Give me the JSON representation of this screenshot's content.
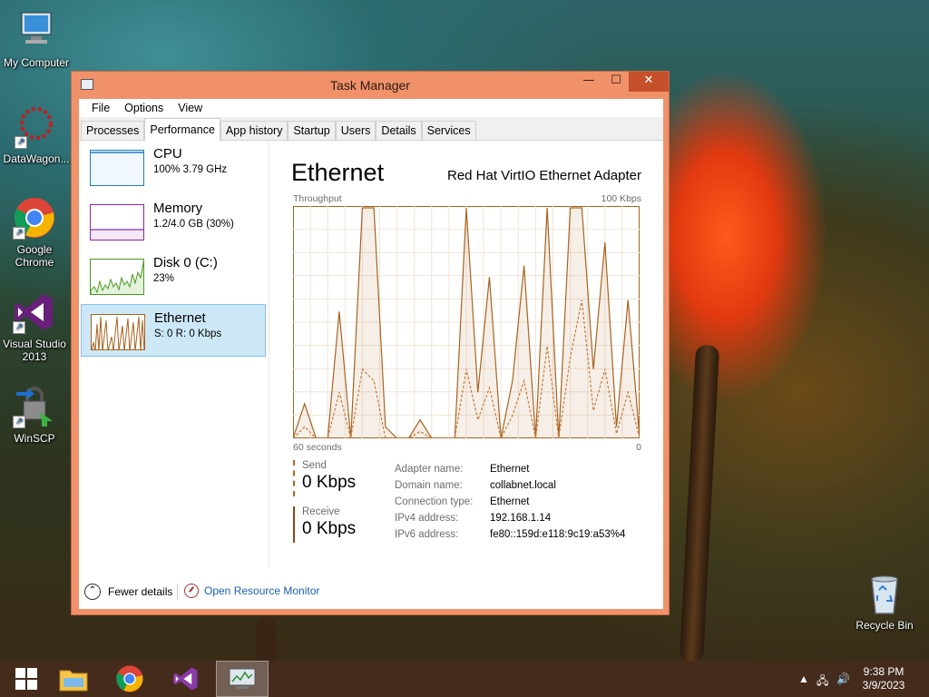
{
  "desktop": {
    "icons": [
      {
        "label": "My Computer",
        "icon": "computer-icon"
      },
      {
        "label": "DataWagon...",
        "icon": "datawagon-icon"
      },
      {
        "label": "Google\nChrome",
        "icon": "chrome-icon"
      },
      {
        "label": "Visual Studio\n2013",
        "icon": "visual-studio-icon"
      },
      {
        "label": "WinSCP",
        "icon": "winscp-icon"
      },
      {
        "label": "Recycle Bin",
        "icon": "recycle-bin-icon"
      }
    ]
  },
  "window": {
    "title": "Task Manager",
    "controls": {
      "minimize": "—",
      "maximize": "☐",
      "close": "✕"
    },
    "menu": [
      "File",
      "Options",
      "View"
    ],
    "tabs": [
      "Processes",
      "Performance",
      "App history",
      "Startup",
      "Users",
      "Details",
      "Services"
    ],
    "active_tab": "Performance"
  },
  "perf_list": [
    {
      "name": "CPU",
      "sub": "100%  3.79 GHz",
      "color": "#1b7fbf"
    },
    {
      "name": "Memory",
      "sub": "1.2/4.0 GB (30%)",
      "color": "#8b28a8"
    },
    {
      "name": "Disk 0 (C:)",
      "sub": "23%",
      "color": "#4a9a1f"
    },
    {
      "name": "Ethernet",
      "sub": "S: 0  R: 0 Kbps",
      "color": "#a8631e"
    }
  ],
  "detail": {
    "heading": "Ethernet",
    "adapter": "Red Hat VirtIO Ethernet Adapter",
    "throughput_label": "Throughput",
    "throughput_max": "100 Kbps",
    "axis_left": "60 seconds",
    "axis_right": "0",
    "send_label": "Send",
    "send_value": "0 Kbps",
    "receive_label": "Receive",
    "receive_value": "0 Kbps",
    "properties": [
      {
        "key": "Adapter name:",
        "value": "Ethernet"
      },
      {
        "key": "Domain name:",
        "value": "collabnet.local"
      },
      {
        "key": "Connection type:",
        "value": "Ethernet"
      },
      {
        "key": "IPv4 address:",
        "value": "192.168.1.14"
      },
      {
        "key": "IPv6 address:",
        "value": "fe80::159d:e118:9c19:a53%4"
      }
    ]
  },
  "footer": {
    "fewer_details": "Fewer details",
    "open_resource_monitor": "Open Resource Monitor"
  },
  "chart_data": {
    "type": "line",
    "title": "Throughput",
    "ylim": [
      0,
      100
    ],
    "ylabel": "Kbps",
    "x": [
      60,
      58,
      56,
      54,
      52,
      50,
      48,
      46,
      44,
      42,
      40,
      38,
      36,
      34,
      32,
      30,
      28,
      26,
      24,
      22,
      20,
      18,
      16,
      14,
      12,
      10,
      8,
      6,
      4,
      2,
      0
    ],
    "series": [
      {
        "name": "Send",
        "values": [
          0,
          15,
          0,
          0,
          55,
          0,
          100,
          100,
          5,
          0,
          0,
          8,
          0,
          0,
          0,
          100,
          20,
          70,
          0,
          25,
          75,
          0,
          100,
          0,
          100,
          100,
          30,
          85,
          5,
          60,
          0
        ]
      },
      {
        "name": "Receive",
        "values": [
          0,
          5,
          0,
          0,
          20,
          0,
          30,
          25,
          0,
          0,
          0,
          3,
          0,
          0,
          0,
          30,
          8,
          22,
          0,
          10,
          25,
          0,
          40,
          0,
          35,
          60,
          12,
          30,
          2,
          20,
          0
        ]
      }
    ]
  },
  "taskbar": {
    "items": [
      "start-button",
      "file-explorer",
      "chrome",
      "visual-studio",
      "task-manager"
    ],
    "time": "9:38 PM",
    "date": "3/9/2023"
  }
}
